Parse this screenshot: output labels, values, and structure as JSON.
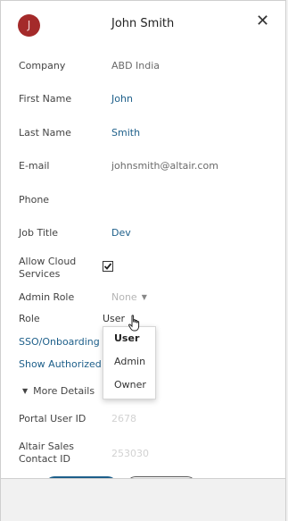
{
  "header": {
    "avatar_initial": "J",
    "user_name": "John Smith",
    "close_glyph": "✕"
  },
  "fields": {
    "company": {
      "label": "Company",
      "value": "ABD India"
    },
    "first_name": {
      "label": "First Name",
      "value": "John"
    },
    "last_name": {
      "label": "Last Name",
      "value": "Smith"
    },
    "email": {
      "label": "E-mail",
      "value": "johnsmith@altair.com"
    },
    "phone": {
      "label": "Phone",
      "value": ""
    },
    "job_title": {
      "label": "Job Title",
      "value": "Dev"
    },
    "allow_cloud": {
      "label_line1": "Allow Cloud",
      "label_line2": "Services",
      "checked": true
    },
    "admin_role": {
      "label": "Admin Role",
      "value": "None"
    },
    "role": {
      "label": "Role",
      "value": "User"
    }
  },
  "links": {
    "sso": "SSO/Onboarding Settings",
    "authorized": "Show Authorized Machines"
  },
  "more_details": {
    "label": "More Details"
  },
  "details": {
    "portal_user_id": {
      "label": "Portal User ID",
      "value": "2678"
    },
    "sales_contact": {
      "label_line1": "Altair Sales",
      "label_line2": "Contact ID",
      "value": "253030"
    }
  },
  "role_dropdown": {
    "options": [
      "User",
      "Admin",
      "Owner"
    ],
    "selected": "User"
  },
  "colors": {
    "accent": "#1d5f8a",
    "avatar": "#a42a2a"
  },
  "icons": {
    "close": "close-icon",
    "check": "check-icon",
    "caret": "chevron-down-icon",
    "cursor": "hand-pointer-icon"
  }
}
